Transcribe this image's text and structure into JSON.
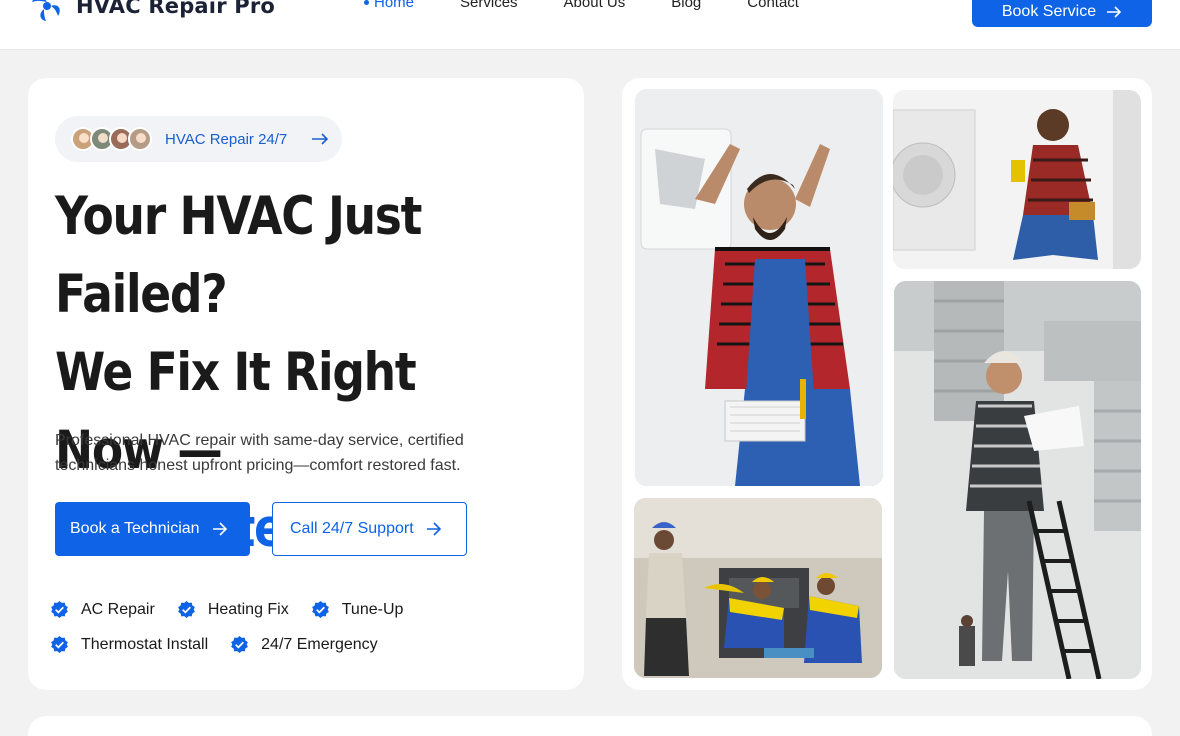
{
  "header": {
    "logo_text": "HVAC Repair Pro",
    "nav": [
      {
        "label": "Home",
        "active": true
      },
      {
        "label": "Services",
        "active": false
      },
      {
        "label": "About Us",
        "active": false
      },
      {
        "label": "Blog",
        "active": false
      },
      {
        "label": "Contact",
        "active": false
      }
    ],
    "cta_label": "Book Service"
  },
  "hero": {
    "badge_label": "HVAC Repair 24/7",
    "headline_line1": "Your HVAC Just Failed?",
    "headline_line2": "We Fix It Right Now —",
    "headline_line3": "Guaranteed.",
    "subtext": "Professional HVAC repair with same-day service, certified technicians honest upfront pricing—comfort restored fast.",
    "primary_cta": "Book a Technician",
    "secondary_cta": "Call 24/7 Support",
    "features": [
      "AC Repair",
      "Heating Fix",
      "Tune-Up",
      "Thermostat Install",
      "24/7 Emergency"
    ]
  },
  "colors": {
    "accent": "#0f63e6",
    "text": "#1a1a1a",
    "background": "#f2f2f2"
  },
  "icons": {
    "arrow": "arrow-right-icon",
    "check": "check-badge-icon",
    "logo": "fan-logo-icon"
  }
}
